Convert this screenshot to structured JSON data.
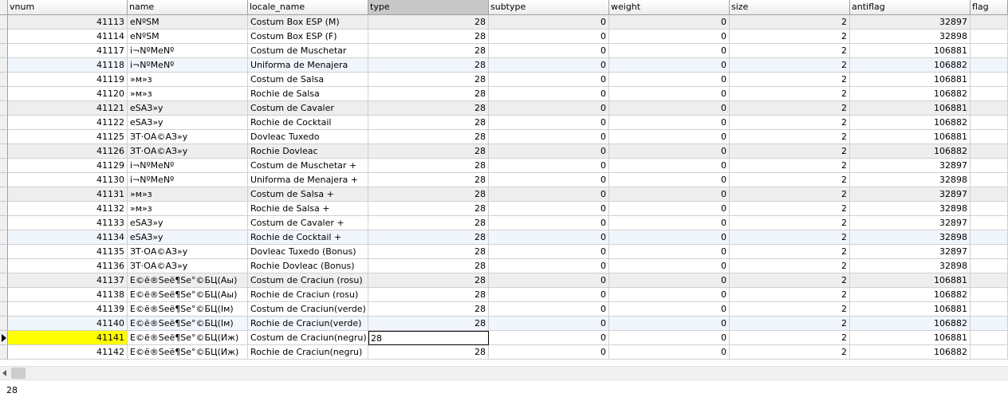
{
  "columns": [
    "vnum",
    "name",
    "locale_name",
    "type",
    "subtype",
    "weight",
    "size",
    "antiflag",
    "flag"
  ],
  "rows": [
    {
      "vnum": "41113",
      "name": "еNºSM",
      "locale_name": "Costum Box ESP (M)",
      "type": "28",
      "subtype": "0",
      "weight": "0",
      "size": "2",
      "antiflag": "32897"
    },
    {
      "vnum": "41114",
      "name": "еNºSM",
      "locale_name": "Costum Box ESP (F)",
      "type": "28",
      "subtype": "0",
      "weight": "0",
      "size": "2",
      "antiflag": "32898"
    },
    {
      "vnum": "41117",
      "name": "і¬NºМеNº",
      "locale_name": "Costum de Muschetar",
      "type": "28",
      "subtype": "0",
      "weight": "0",
      "size": "2",
      "antiflag": "106881"
    },
    {
      "vnum": "41118",
      "name": "і¬NºМеNº",
      "locale_name": "Uniforma de Menajera",
      "type": "28",
      "subtype": "0",
      "weight": "0",
      "size": "2",
      "antiflag": "106882"
    },
    {
      "vnum": "41119",
      "name": "»м»з",
      "locale_name": "Costum de Salsa",
      "type": "28",
      "subtype": "0",
      "weight": "0",
      "size": "2",
      "antiflag": "106881"
    },
    {
      "vnum": "41120",
      "name": "»м»з",
      "locale_name": "Rochie de Salsa",
      "type": "28",
      "subtype": "0",
      "weight": "0",
      "size": "2",
      "antiflag": "106882"
    },
    {
      "vnum": "41121",
      "name": "еSАЗ»у",
      "locale_name": "Costum de Cavaler",
      "type": "28",
      "subtype": "0",
      "weight": "0",
      "size": "2",
      "antiflag": "106881"
    },
    {
      "vnum": "41122",
      "name": "еSАЗ»у",
      "locale_name": "Rochie de Cocktail",
      "type": "28",
      "subtype": "0",
      "weight": "0",
      "size": "2",
      "antiflag": "106882"
    },
    {
      "vnum": "41125",
      "name": "ЗТ·ОА©АЗ»у",
      "locale_name": "Dovleac Tuxedo",
      "type": "28",
      "subtype": "0",
      "weight": "0",
      "size": "2",
      "antiflag": "106881"
    },
    {
      "vnum": "41126",
      "name": "ЗТ·ОА©АЗ»у",
      "locale_name": "Rochie Dovleac",
      "type": "28",
      "subtype": "0",
      "weight": "0",
      "size": "2",
      "antiflag": "106882"
    },
    {
      "vnum": "41129",
      "name": "і¬NºМеNº",
      "locale_name": "Costum de Muschetar +",
      "type": "28",
      "subtype": "0",
      "weight": "0",
      "size": "2",
      "antiflag": "32897"
    },
    {
      "vnum": "41130",
      "name": "і¬NºМеNº",
      "locale_name": "Uniforma de Menajera +",
      "type": "28",
      "subtype": "0",
      "weight": "0",
      "size": "2",
      "antiflag": "32898"
    },
    {
      "vnum": "41131",
      "name": "»м»з",
      "locale_name": "Costum de Salsa +",
      "type": "28",
      "subtype": "0",
      "weight": "0",
      "size": "2",
      "antiflag": "32897"
    },
    {
      "vnum": "41132",
      "name": "»м»з",
      "locale_name": "Rochie de Salsa +",
      "type": "28",
      "subtype": "0",
      "weight": "0",
      "size": "2",
      "antiflag": "32898"
    },
    {
      "vnum": "41133",
      "name": "еSАЗ»у",
      "locale_name": "Costum de Cavaler +",
      "type": "28",
      "subtype": "0",
      "weight": "0",
      "size": "2",
      "antiflag": "32897"
    },
    {
      "vnum": "41134",
      "name": "еSАЗ»у",
      "locale_name": "Rochie de Cocktail +",
      "type": "28",
      "subtype": "0",
      "weight": "0",
      "size": "2",
      "antiflag": "32898"
    },
    {
      "vnum": "41135",
      "name": "ЗТ·ОА©АЗ»у",
      "locale_name": "Dovleac Tuxedo (Bonus)",
      "type": "28",
      "subtype": "0",
      "weight": "0",
      "size": "2",
      "antiflag": "32897"
    },
    {
      "vnum": "41136",
      "name": "ЗТ·ОА©АЗ»у",
      "locale_name": "Rochie Dovleac (Bonus)",
      "type": "28",
      "subtype": "0",
      "weight": "0",
      "size": "2",
      "antiflag": "32898"
    },
    {
      "vnum": "41137",
      "name": "Е©ё®Sеё¶Sе°©БЦ(Аы)",
      "locale_name": "Costum de Craciun (rosu)",
      "type": "28",
      "subtype": "0",
      "weight": "0",
      "size": "2",
      "antiflag": "106881"
    },
    {
      "vnum": "41138",
      "name": "Е©ё®Sеё¶Sе°©БЦ(Аы)",
      "locale_name": "Rochie de Craciun (rosu)",
      "type": "28",
      "subtype": "0",
      "weight": "0",
      "size": "2",
      "antiflag": "106882"
    },
    {
      "vnum": "41139",
      "name": "Е©ё®Sеё¶Sе°©БЦ(Ім)",
      "locale_name": "Costum de Craciun(verde)",
      "type": "28",
      "subtype": "0",
      "weight": "0",
      "size": "2",
      "antiflag": "106881"
    },
    {
      "vnum": "41140",
      "name": "Е©ё®Sеё¶Sе°©БЦ(Ім)",
      "locale_name": "Rochie de Craciun(verde)",
      "type": "28",
      "subtype": "0",
      "weight": "0",
      "size": "2",
      "antiflag": "106882"
    },
    {
      "vnum": "41141",
      "name": "Е©ё®Sеё¶Sе°©БЦ(Иж)",
      "locale_name": "Costum de Craciun(negru)",
      "type": "28",
      "subtype": "0",
      "weight": "0",
      "size": "2",
      "antiflag": "106881"
    },
    {
      "vnum": "41142",
      "name": "Е©ё®Sеё¶Sе°©БЦ(Иж)",
      "locale_name": "Rochie de Craciun(negru)",
      "type": "28",
      "subtype": "0",
      "weight": "0",
      "size": "2",
      "antiflag": "106882"
    }
  ],
  "editing": {
    "row_index": 22,
    "column": "type",
    "value": "28"
  },
  "status_text": "28",
  "icons": {
    "row_indicator": "triangle-right-icon",
    "scroll_left": "chevron-left-icon"
  },
  "colors": {
    "selected_cell": "#ffff00",
    "sorted_header": "#c8c8c8",
    "alt_row": "#eeeeee"
  }
}
